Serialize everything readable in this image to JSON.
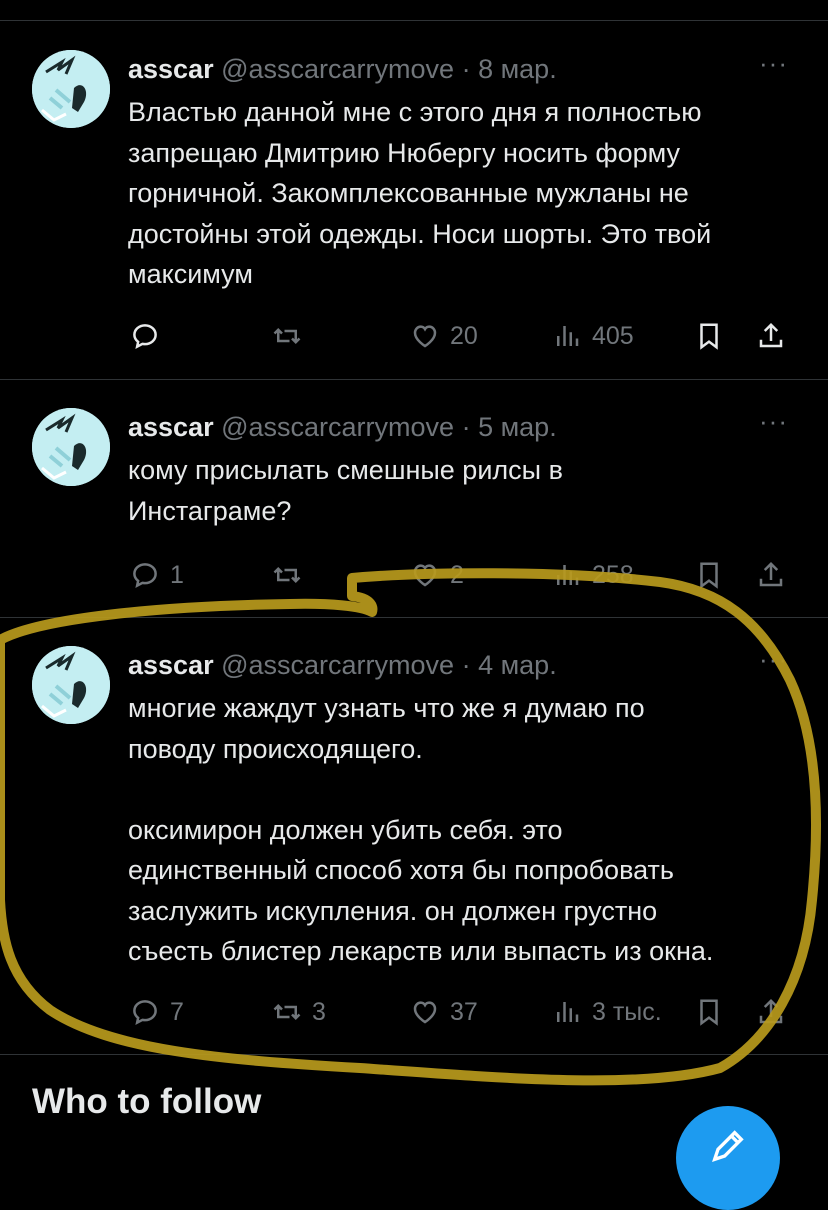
{
  "tweets": [
    {
      "name": "asscar",
      "handle": "@asscarcarrymove",
      "separator": " · ",
      "date": "8 мар.",
      "more": "···",
      "text": "Властью данной мне с этого дня я полностью\nзапрещаю Дмитрию Нюбергу носить форму\nгорничной. Закомплексованные мужланы не\nдостойны этой одежды. Носи шорты. Это твой\nмаксимум",
      "replies": "",
      "retweets": "",
      "likes": "20",
      "views": "405"
    },
    {
      "name": "asscar",
      "handle": "@asscarcarrymove",
      "separator": " · ",
      "date": "5 мар.",
      "more": "···",
      "text": "кому присылать смешные рилсы в\nИнстаграме?",
      "replies": "1",
      "retweets": "",
      "likes": "2",
      "views": "258"
    },
    {
      "name": "asscar",
      "handle": "@asscarcarrymove",
      "separator": " · ",
      "date": "4 мар.",
      "more": "···",
      "text": "многие жаждут узнать что же я думаю по\nповоду происходящего.\n\nоксимирон должен убить себя. это\nединственный способ хотя бы попробовать\nзаслужить искупления. он должен грустно\nсъесть блистер лекарств или выпасть из окна.",
      "replies": "7",
      "retweets": "3",
      "likes": "37",
      "views": "3 тыс."
    }
  ],
  "who_to_follow": "Who to follow",
  "icons": {
    "reply": "reply-icon",
    "retweet": "retweet-icon",
    "like": "heart-icon",
    "views": "views-icon",
    "bookmark": "bookmark-icon",
    "share": "share-icon",
    "compose": "compose-icon"
  },
  "colors": {
    "background": "#000000",
    "text": "#e7e9ea",
    "muted": "#71767b",
    "divider": "#2f3336",
    "accent": "#1d9bf0",
    "highlight_marker": "#b99a1c"
  }
}
